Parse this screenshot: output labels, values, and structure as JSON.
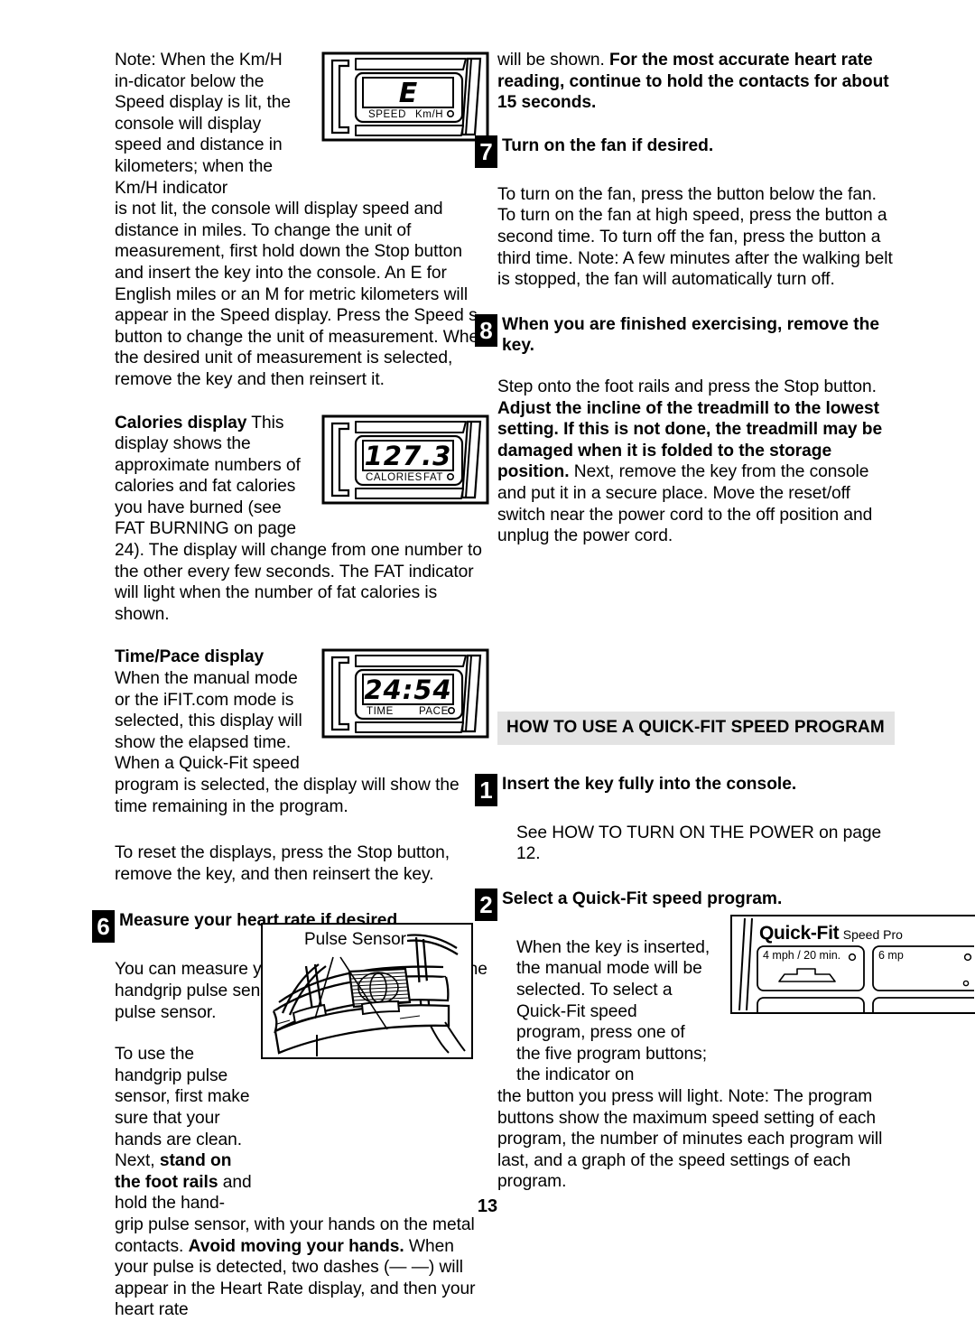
{
  "page": {
    "number": "13"
  },
  "left_column": {
    "note_para_start": "Note: When the Km/H in-dicator below the Speed display is lit, the console will display speed and distance in kilometers; when the Km/H indicator",
    "note_para_cont": "is not lit, the console will display speed and distance in miles. To change the unit of measurement, first hold down the Stop button and insert the key into the console. An  E  for English miles or an  M  for metric kilometers will appear in the Speed display. Press the Speed s button to change the unit of measurement. When the desired unit of measurement is selected, remove the key and then reinsert it.",
    "calories": {
      "heading": "Calories display",
      "text_narrow": " This display shows the approximate numbers of calories and fat calories you have burned (see FAT BURNING on page",
      "text_full": "24). The display will change from one number to the other every few seconds. The FAT indicator will light when the number of fat calories is shown."
    },
    "timepace": {
      "heading": "Time/Pace display",
      "text_narrow": "When the manual mode or the iFIT.com mode is selected, this display will show the elapsed time. When a Quick-Fit speed",
      "text_full": "program is selected, the display will show the time remaining in the program."
    },
    "reset_para": "To reset the displays, press the Stop button, remove the key, and then reinsert the key.",
    "step6": {
      "num": "6",
      "title": "Measure your heart rate if desired.",
      "para1": "You can measure your heart rate using either the handgrip pulse sensor or the optional chest pulse sensor.",
      "para2_narrow_a": "To use the handgrip pulse sensor, first make sure that your hands are clean. Next, ",
      "para2_narrow_b": "stand on the foot rails",
      "para2_narrow_c": " and hold the hand-",
      "para2_full_a": "grip pulse sensor, with your hands on the metal contacts. ",
      "para2_full_b": "Avoid moving your hands.",
      "para2_full_c": " When your pulse is detected, two dashes (— —) will appear in the Heart Rate display, and then your heart rate"
    }
  },
  "right_column": {
    "heartrate_para_a": "will be shown. ",
    "heartrate_para_b": "For the most accurate heart rate reading, continue to hold the contacts for about 15 seconds.",
    "step7": {
      "num": "7",
      "title": "Turn on the fan if desired.",
      "para": "To turn on the fan, press the button below the fan. To turn on the fan at high speed, press the button a second time. To turn off the fan, press the button a third time. Note: A few minutes after the walking belt is stopped, the fan will automatically turn off."
    },
    "step8": {
      "num": "8",
      "title": "When you are finished exercising, remove the key.",
      "para_a": "Step onto the foot rails and press the Stop button. ",
      "para_b": "Adjust the incline of the treadmill to the lowest setting. If this is not done, the treadmill may be damaged when it is folded to the storage position.",
      "para_c": " Next, remove the key from the console and put it in a secure place. Move the reset/off switch near the power cord to the off position and unplug the power cord."
    },
    "section_heading": "HOW TO USE A QUICK-FIT SPEED PROGRAM",
    "step1": {
      "num": "1",
      "title": "Insert the key fully into the console.",
      "para": "See HOW TO TURN ON THE POWER on page 12."
    },
    "step2": {
      "num": "2",
      "title": "Select a Quick-Fit speed program.",
      "para_narrow": "When the key is inserted, the manual mode will be selected. To select a Quick-Fit speed program, press one of the five program buttons; the indicator on",
      "para_full": "the button you press will light. Note: The program buttons show the maximum speed setting of each program, the number of minutes each program will last, and a graph of the speed settings of each program."
    }
  },
  "illustrations": {
    "speed_display": {
      "value": "E",
      "label_left": "SPEED",
      "label_right": "Km/H"
    },
    "calories_display": {
      "value": "127.3",
      "label_left": "CALORIES",
      "label_right": "FAT"
    },
    "time_display": {
      "value": "24:54",
      "label_left": "TIME",
      "label_right": "PACE"
    },
    "pulse_sensor": {
      "caption": "Pulse Sensor"
    },
    "quickfit_console": {
      "title_main": "Quick-Fit",
      "title_sub": "Speed Pro",
      "button1": "4 mph / 20 min.",
      "button2": "6 mp"
    }
  }
}
